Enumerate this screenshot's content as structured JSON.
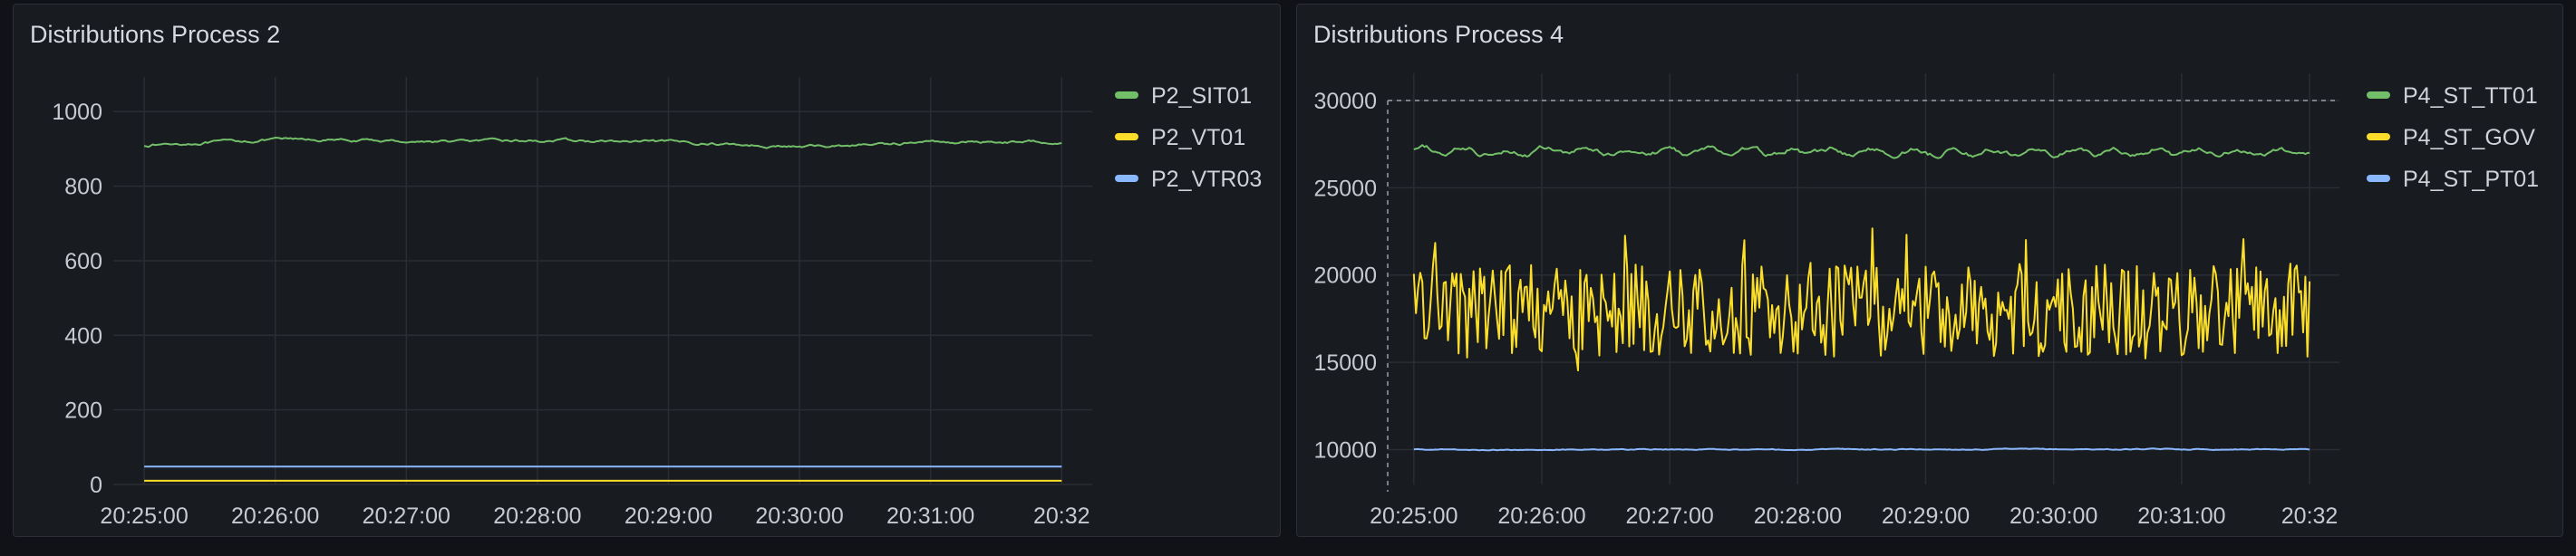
{
  "panels": [
    {
      "title": "Distributions Process 2"
    },
    {
      "title": "Distributions Process 4"
    }
  ],
  "chart_data": [
    {
      "type": "line",
      "title": "Distributions Process 2",
      "x_ticks": [
        "20:25:00",
        "20:26:00",
        "20:27:00",
        "20:28:00",
        "20:29:00",
        "20:30:00",
        "20:31:00",
        "20:32"
      ],
      "x_range": [
        "20:24:50",
        "20:32:14"
      ],
      "y_ticks": [
        0,
        200,
        400,
        600,
        800,
        1000
      ],
      "ylim": [
        0,
        1020
      ],
      "grid": true,
      "legend_position": "right",
      "series": [
        {
          "name": "P2_SIT01",
          "color": "#73bf69",
          "x_start": "20:25:00",
          "x_end": "20:32:00",
          "mean": 915,
          "segments": [
            [
              0,
              910
            ],
            [
              0.15,
              925
            ],
            [
              0.3,
              920
            ],
            [
              0.45,
              922
            ],
            [
              0.6,
              916
            ],
            [
              0.72,
              905
            ],
            [
              0.85,
              918
            ],
            [
              1.0,
              920
            ]
          ],
          "noise": 5
        },
        {
          "name": "P2_VT01",
          "color": "#fade2a",
          "x_start": "20:25:00",
          "x_end": "20:32:00",
          "mean": 10,
          "segments": [
            [
              0,
              10
            ],
            [
              1.0,
              10
            ]
          ],
          "noise": 0
        },
        {
          "name": "P2_VTR03",
          "color": "#8ab8ff",
          "x_start": "20:25:00",
          "x_end": "20:32:00",
          "mean": 48,
          "segments": [
            [
              0,
              48
            ],
            [
              1.0,
              48
            ]
          ],
          "noise": 0
        }
      ]
    },
    {
      "type": "line",
      "title": "Distributions Process 4",
      "x_ticks": [
        "20:25:00",
        "20:26:00",
        "20:27:00",
        "20:28:00",
        "20:29:00",
        "20:30:00",
        "20:31:00",
        "20:32"
      ],
      "x_range": [
        "20:24:52",
        "20:32:14"
      ],
      "y_ticks": [
        10000,
        15000,
        20000,
        25000,
        30000
      ],
      "ylim": [
        8000,
        30000
      ],
      "grid": true,
      "threshold": 30000,
      "legend_position": "right",
      "series": [
        {
          "name": "P4_ST_TT01",
          "color": "#73bf69",
          "x_start": "20:25:00",
          "x_end": "20:32:00",
          "mean": 27100,
          "segments": [
            [
              0,
              27100
            ],
            [
              1.0,
              27000
            ]
          ],
          "noise": 200,
          "wave_amplitude": 180,
          "wave_cycles": 22
        },
        {
          "name": "P4_ST_GOV",
          "color": "#fade2a",
          "x_start": "20:25:00",
          "x_end": "20:32:00",
          "mean": 18000,
          "segments": [
            [
              0,
              18000
            ],
            [
              1.0,
              18000
            ]
          ],
          "noise": 3000,
          "spike_max": 23000,
          "spike_min": 14500
        },
        {
          "name": "P4_ST_PT01",
          "color": "#8ab8ff",
          "x_start": "20:25:00",
          "x_end": "20:32:00",
          "mean": 10020,
          "segments": [
            [
              0,
              10000
            ],
            [
              1.0,
              10020
            ]
          ],
          "noise": 40
        }
      ]
    }
  ]
}
